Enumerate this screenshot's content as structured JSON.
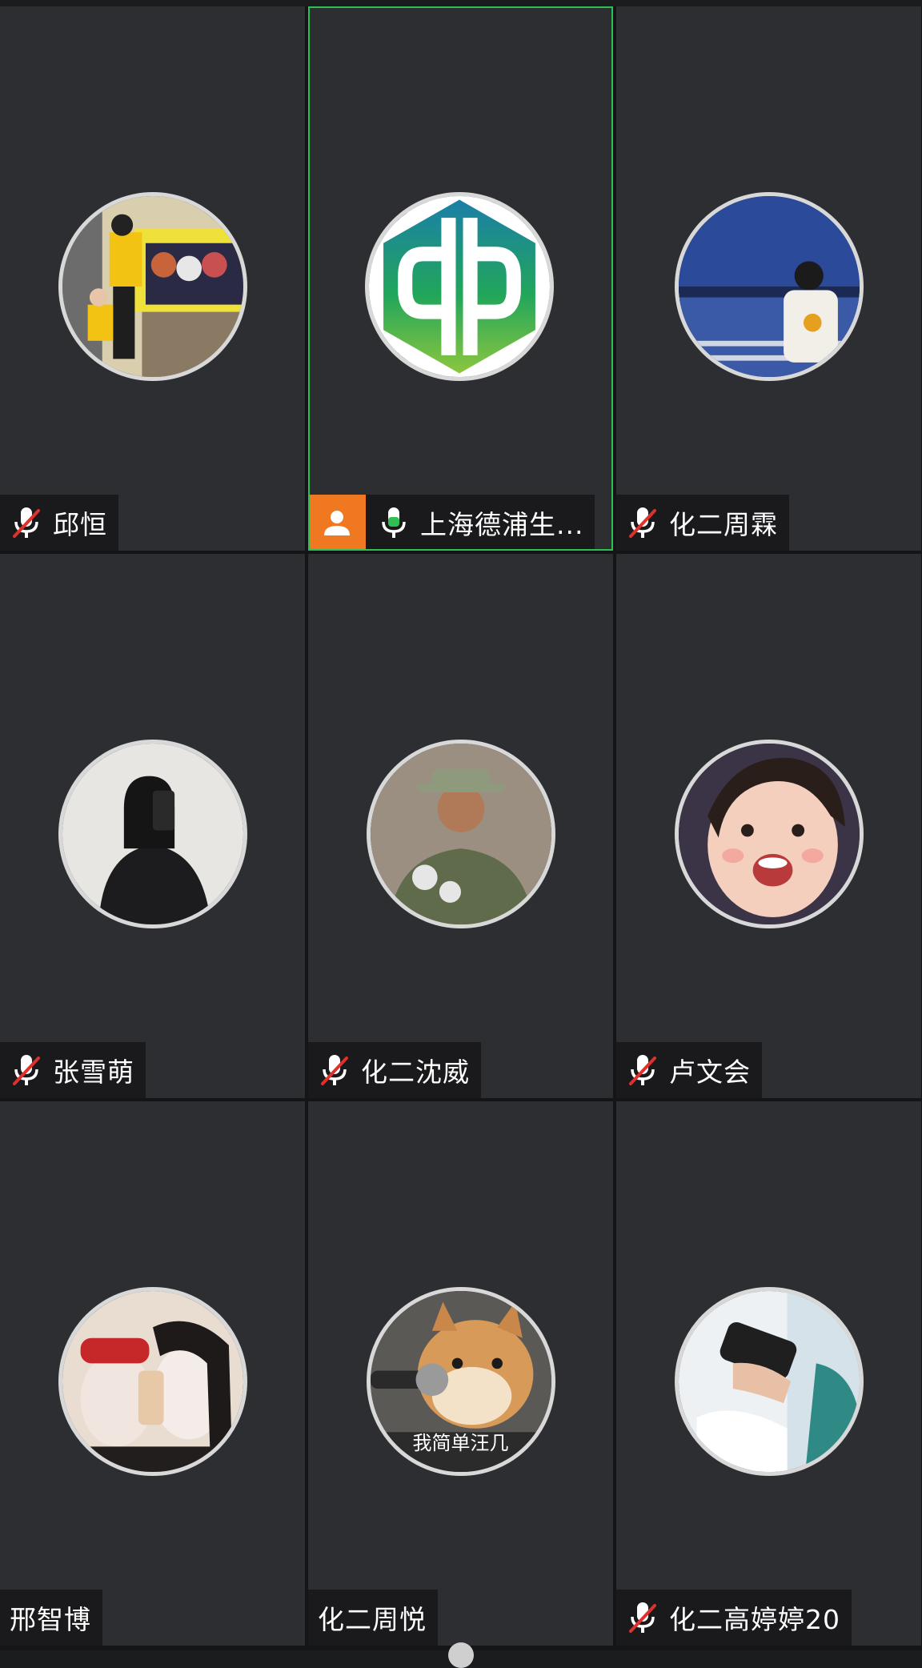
{
  "participants": [
    {
      "name": "邱恒",
      "mic": "muted",
      "avatar": "painting-photo-avatar"
    },
    {
      "name": "上海德浦生...",
      "mic": "active",
      "host": true,
      "speaking": true,
      "avatar": "company-logo-avatar"
    },
    {
      "name": "化二周霖",
      "mic": "muted",
      "avatar": "night-bridge-photo-avatar"
    },
    {
      "name": "张雪萌",
      "mic": "muted",
      "avatar": "mirror-selfie-avatar"
    },
    {
      "name": "化二沈威",
      "mic": "muted",
      "avatar": "soldier-photo-avatar"
    },
    {
      "name": "卢文会",
      "mic": "muted",
      "avatar": "laughing-child-avatar"
    },
    {
      "name": "邢智博",
      "mic": "none",
      "avatar": "face-mask-selfie-avatar"
    },
    {
      "name": "化二周悦",
      "mic": "none",
      "avatar": "shiba-meme-avatar",
      "caption": "我简单汪几"
    },
    {
      "name": "化二高婷婷20",
      "mic": "muted",
      "avatar": "phone-hand-photo-avatar"
    }
  ],
  "colors": {
    "tile_bg": "#2c2e32",
    "active_border": "#2fbf52",
    "host_badge": "#f07820",
    "mic_active": "#2fbf52",
    "mic_muted_slash": "#e0302c"
  }
}
